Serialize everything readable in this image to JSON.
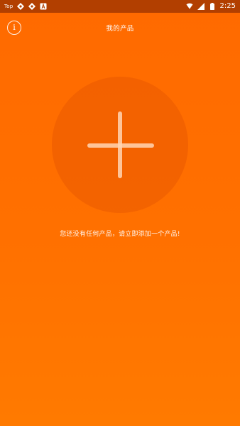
{
  "status_bar": {
    "carrier": "Top",
    "time": "2:25"
  },
  "header": {
    "info_icon": "info-circle-icon",
    "info_glyph": "i",
    "title": "我的产品"
  },
  "main": {
    "add_icon": "plus-icon",
    "empty_message": "您还没有任何产品，请立即添加一个产品!"
  },
  "colors": {
    "background_top": "#ff6a00",
    "background_bottom": "#ff7a00",
    "status_bar": "#b23f00"
  }
}
